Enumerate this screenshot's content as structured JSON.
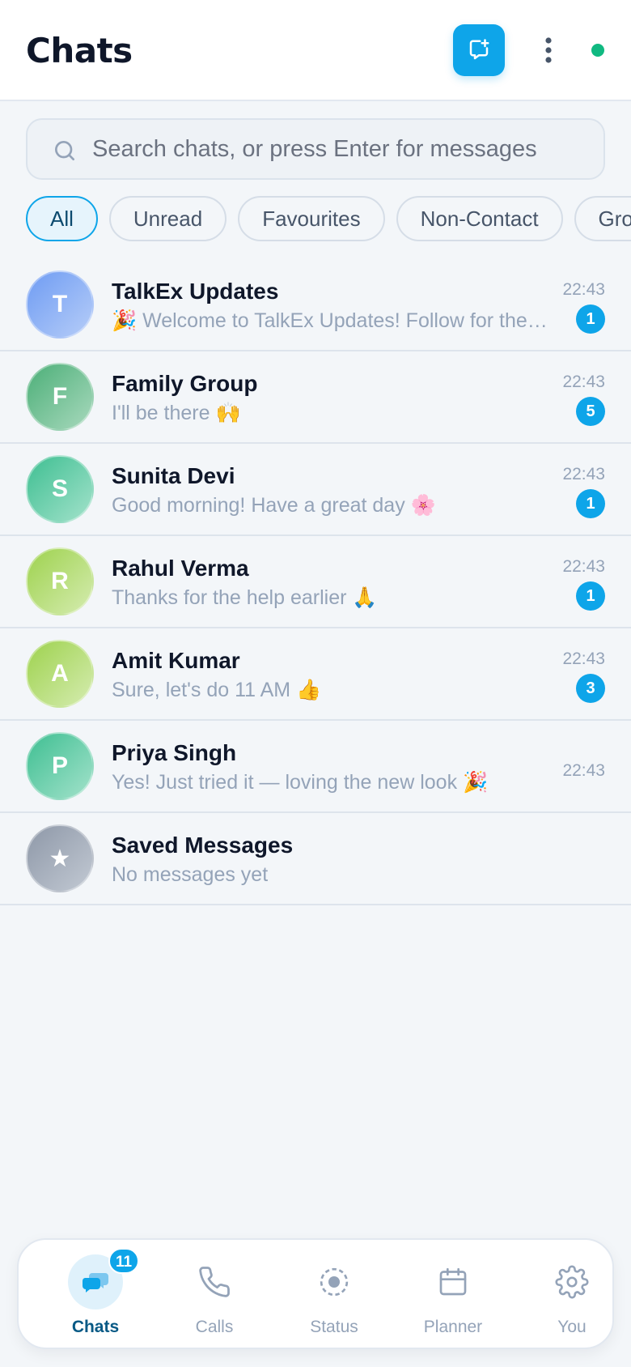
{
  "header": {
    "title": "Chats",
    "new_chat_icon": "new-chat-icon",
    "menu_icon": "more-vertical-icon",
    "online_status_color": "#10b981",
    "accent_color": "#0ea5e9"
  },
  "search": {
    "placeholder": "Search chats, or press Enter for messages",
    "value": ""
  },
  "filters": [
    {
      "label": "All",
      "active": true
    },
    {
      "label": "Unread",
      "active": false
    },
    {
      "label": "Favourites",
      "active": false
    },
    {
      "label": "Non-Contact",
      "active": false
    },
    {
      "label": "Gro",
      "active": false
    }
  ],
  "chats": [
    {
      "initial": "T",
      "name": "TalkEx Updates",
      "preview": "🎉 Welcome to TalkEx Updates! Follow for the latest news",
      "time": "22:43",
      "unread": "1",
      "color_from": "#6f9cf3",
      "color_to": "#b6cdf8"
    },
    {
      "initial": "F",
      "name": "Family Group",
      "preview": "I'll be there 🙌",
      "time": "22:43",
      "unread": "5",
      "color_from": "#4caf78",
      "color_to": "#a8d9bd"
    },
    {
      "initial": "S",
      "name": "Sunita Devi",
      "preview": "Good morning! Have a great day 🌸",
      "time": "22:43",
      "unread": "1",
      "color_from": "#3fbf92",
      "color_to": "#a3e2cb"
    },
    {
      "initial": "R",
      "name": "Rahul Verma",
      "preview": "Thanks for the help earlier 🙏",
      "time": "22:43",
      "unread": "1",
      "color_from": "#9ed24e",
      "color_to": "#d5ecb0"
    },
    {
      "initial": "A",
      "name": "Amit Kumar",
      "preview": "Sure, let's do 11 AM 👍",
      "time": "22:43",
      "unread": "3",
      "color_from": "#9ed24e",
      "color_to": "#d5ecb0"
    },
    {
      "initial": "P",
      "name": "Priya Singh",
      "preview": "Yes! Just tried it — loving the new look 🎉",
      "time": "22:43",
      "unread": "",
      "color_from": "#3fbf92",
      "color_to": "#a3e2cb"
    },
    {
      "initial": "★",
      "name": "Saved Messages",
      "preview": "No messages yet",
      "time": "",
      "unread": "",
      "color_from": "#8e98a8",
      "color_to": "#c2c9d3"
    }
  ],
  "bottom_nav": {
    "items": [
      {
        "label": "Chats",
        "icon": "chat-bubbles-icon",
        "active": true,
        "badge": "11"
      },
      {
        "label": "Calls",
        "icon": "phone-icon",
        "active": false,
        "badge": ""
      },
      {
        "label": "Status",
        "icon": "status-ring-icon",
        "active": false,
        "badge": ""
      },
      {
        "label": "Planner",
        "icon": "calendar-icon",
        "active": false,
        "badge": ""
      },
      {
        "label": "You",
        "icon": "gear-icon",
        "active": false,
        "badge": ""
      }
    ]
  }
}
